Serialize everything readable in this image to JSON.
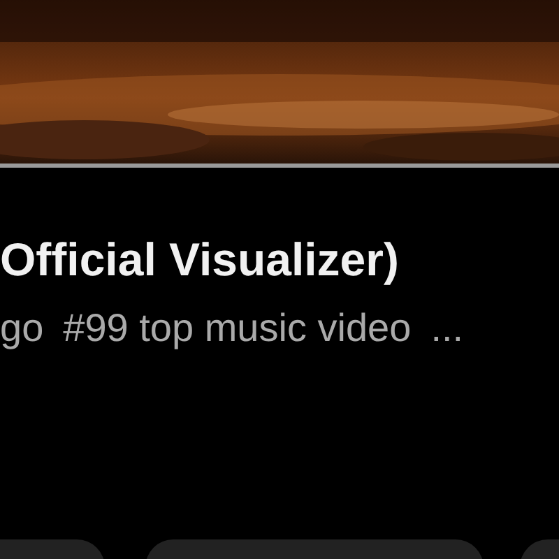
{
  "title": "Official Visualizer)",
  "meta": [
    "go",
    "#99 top music video",
    "..."
  ]
}
